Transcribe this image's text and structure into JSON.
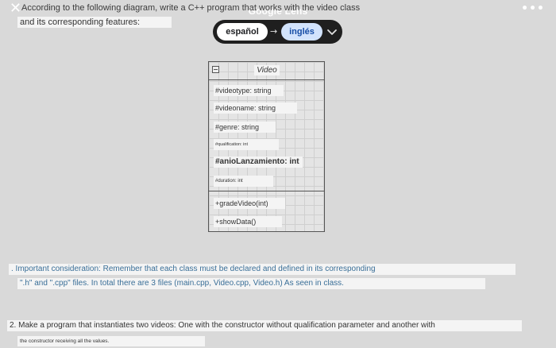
{
  "lens": {
    "title": "Google Lens",
    "close_icon": "close-icon",
    "more_icon": "more-icon",
    "more_glyph": "•••",
    "source_language": "español",
    "target_language": "inglés",
    "arrow_glyph": "→"
  },
  "intro": {
    "line1": "According to the following diagram, write a C++ program that works with the video class",
    "line2": "and its corresponding features:"
  },
  "uml": {
    "class_name": "Video",
    "attributes": [
      "#videotype: string",
      "#videoname: string",
      "#genre: string",
      "#qualification: int",
      "#anioLanzamiento: int",
      "#duration: int"
    ],
    "methods": [
      "+gradeVideo(int)",
      "+showData()"
    ]
  },
  "consideration": {
    "line1": ". Important consideration: Remember that each class must be declared and defined in its corresponding",
    "line2": "\".h\" and \".cpp\" files. In total there are 3 files (main.cpp, Video.cpp, Video.h) As seen in class."
  },
  "task2": {
    "line1": "2. Make a program that instantiates two videos: One with the constructor without qualification parameter and another with",
    "line2": "the constructor receiving all the values."
  },
  "colors": {
    "background": "#d9d9d9",
    "lang_bar": "#1f1f1f",
    "lang_target_bg": "#d2e3fc",
    "lang_target_text": "#174ea6",
    "consideration_text": "#3a6f98"
  }
}
